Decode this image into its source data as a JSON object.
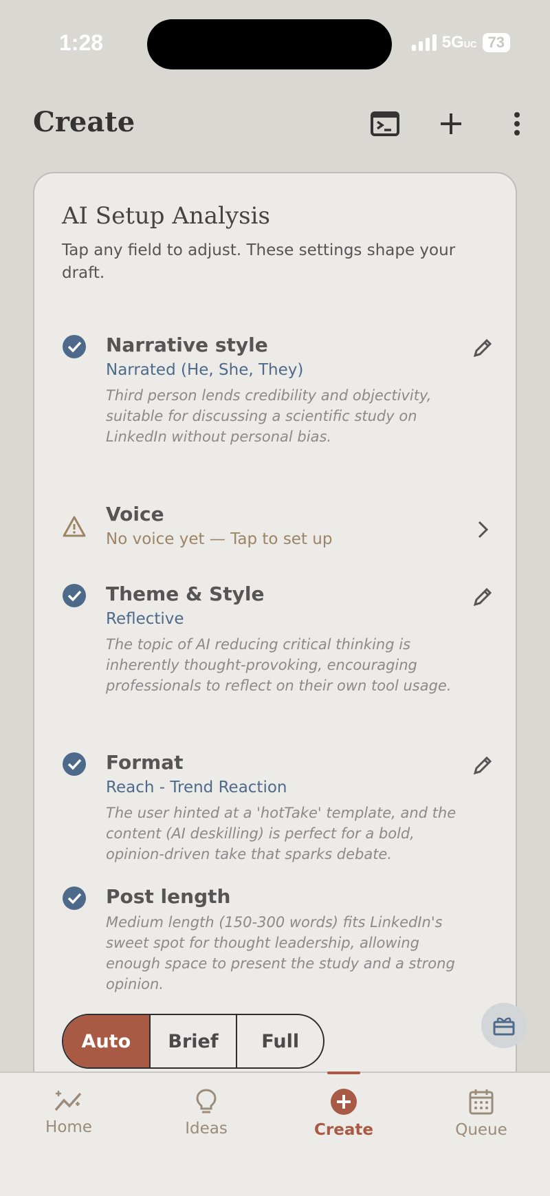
{
  "status_bar": {
    "time": "1:28",
    "network": "5G",
    "network_suffix": "UC",
    "battery": "73"
  },
  "header": {
    "title": "Create",
    "icons": [
      "terminal-icon",
      "plus-icon",
      "more-vertical-icon"
    ]
  },
  "card": {
    "title": "AI Setup Analysis",
    "subtitle": "Tap any field to adjust. These settings shape your draft.",
    "items": [
      {
        "label": "Narrative style",
        "value": "Narrated (He, She, They)",
        "description": "Third person lends credibility and objectivity, suitable for discussing a scientific study on LinkedIn without personal bias.",
        "status_icon": "check-circle-icon",
        "action_icon": "pencil-icon"
      },
      {
        "label": "Voice",
        "value": "No voice yet — Tap to set up",
        "description": "",
        "status_icon": "warning-icon",
        "action_icon": "chevron-right-icon"
      },
      {
        "label": "Theme & Style",
        "value": "Reflective",
        "description": "The topic of AI reducing critical thinking is inherently thought-provoking, encouraging professionals to reflect on their own tool usage.",
        "status_icon": "check-circle-icon",
        "action_icon": "pencil-icon"
      },
      {
        "label": "Format",
        "value": "Reach - Trend Reaction",
        "description": "The user hinted at a 'hotTake' template, and the content (AI deskilling) is perfect for a bold, opinion-driven take that sparks debate.",
        "status_icon": "check-circle-icon",
        "action_icon": "pencil-icon"
      },
      {
        "label": "Post length",
        "value": "",
        "description": "Medium length (150-300 words) fits LinkedIn's sweet spot for thought leadership, allowing enough space to present the study and a strong opinion.",
        "status_icon": "check-circle-icon",
        "action_icon": ""
      }
    ],
    "length_options": [
      "Auto",
      "Brief",
      "Full"
    ],
    "selected_length": "Auto"
  },
  "fab_icon": "gift-icon",
  "nav": {
    "items": [
      {
        "label": "Home",
        "icon": "sparkle-chart-icon"
      },
      {
        "label": "Ideas",
        "icon": "lightbulb-icon"
      },
      {
        "label": "Create",
        "icon": "plus-circle-icon"
      },
      {
        "label": "Queue",
        "icon": "calendar-icon"
      }
    ],
    "active": "Create"
  },
  "colors": {
    "accent": "#a85a45",
    "value_blue": "#4e6a8a",
    "warn": "#9c8465",
    "check": "#4e6a8a"
  }
}
